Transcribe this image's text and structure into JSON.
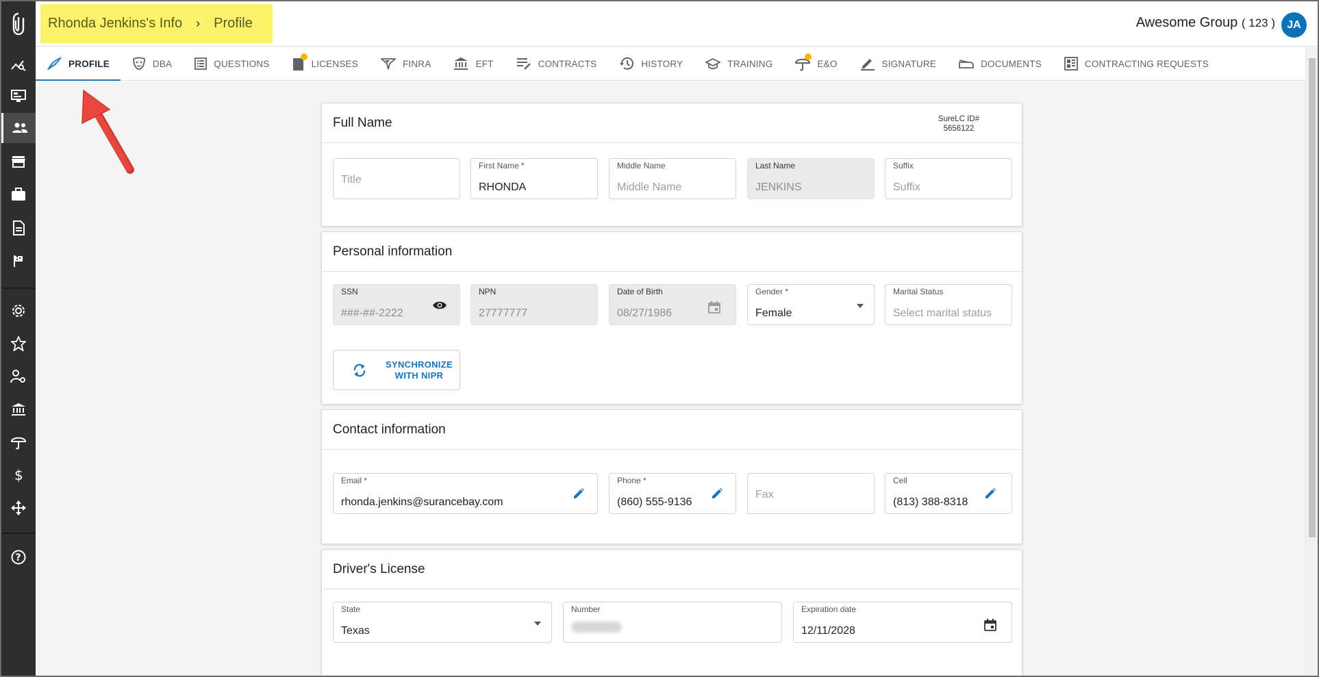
{
  "header": {
    "breadcrumb_root": "Rhonda Jenkins's Info",
    "breadcrumb_page": "Profile",
    "group_label": "Awesome Group",
    "group_count": "( 123 )",
    "avatar_initials": "JA"
  },
  "rail_icons": [
    "logo-icon",
    "analytics-icon",
    "monitor-icon",
    "people-icon",
    "store-icon",
    "briefcase-icon",
    "document-icon",
    "flag-icon",
    "gear-icon",
    "badge-icon",
    "user-settings-icon",
    "bank-icon",
    "umbrella-icon",
    "dollar-icon",
    "move-icon",
    "help-icon"
  ],
  "tabs": [
    {
      "label": "PROFILE",
      "icon": "feather-icon",
      "active": true
    },
    {
      "label": "DBA",
      "icon": "mask-icon"
    },
    {
      "label": "QUESTIONS",
      "icon": "list-icon"
    },
    {
      "label": "LICENSES",
      "icon": "license-icon",
      "badge": true
    },
    {
      "label": "FINRA",
      "icon": "finra-icon"
    },
    {
      "label": "EFT",
      "icon": "bank-icon"
    },
    {
      "label": "CONTRACTS",
      "icon": "contracts-icon"
    },
    {
      "label": "HISTORY",
      "icon": "history-icon"
    },
    {
      "label": "TRAINING",
      "icon": "graduation-icon"
    },
    {
      "label": "E&O",
      "icon": "umbrella-icon",
      "badge": true
    },
    {
      "label": "SIGNATURE",
      "icon": "pen-icon"
    },
    {
      "label": "DOCUMENTS",
      "icon": "stapler-icon"
    },
    {
      "label": "CONTRACTING REQUESTS",
      "icon": "dashboard-icon"
    }
  ],
  "full_name": {
    "title": "Full Name",
    "surelc_label": "SureLC ID#",
    "surelc_id": "5656122",
    "title_field": {
      "placeholder": "Title"
    },
    "first_name": {
      "label": "First Name *",
      "value": "RHONDA"
    },
    "middle_name": {
      "label": "Middle Name",
      "placeholder": "Middle Name"
    },
    "last_name": {
      "label": "Last Name",
      "value": "JENKINS"
    },
    "suffix": {
      "label": "Suffix",
      "placeholder": "Suffix"
    }
  },
  "personal": {
    "title": "Personal information",
    "ssn": {
      "label": "SSN",
      "value": "###-##-2222"
    },
    "npn": {
      "label": "NPN",
      "value": "27777777"
    },
    "dob": {
      "label": "Date of Birth",
      "value": "08/27/1986"
    },
    "gender": {
      "label": "Gender *",
      "value": "Female"
    },
    "marital": {
      "label": "Marital Status",
      "placeholder": "Select marital status"
    },
    "sync_line1": "SYNCHRONIZE",
    "sync_line2": "WITH NIPR"
  },
  "contact": {
    "title": "Contact information",
    "email": {
      "label": "Email *",
      "value": "rhonda.jenkins@surancebay.com"
    },
    "phone": {
      "label": "Phone *",
      "value": "(860) 555-9136"
    },
    "fax": {
      "placeholder": "Fax"
    },
    "cell": {
      "label": "Cell",
      "value": "(813) 388-8318"
    }
  },
  "license": {
    "title": "Driver's License",
    "state": {
      "label": "State",
      "value": "Texas"
    },
    "number": {
      "label": "Number"
    },
    "expiration": {
      "label": "Expiration date",
      "value": "12/11/2028"
    }
  },
  "colors": {
    "accent": "#1b74b7",
    "highlight": "#faf36b",
    "rail": "#2e2e2e",
    "arrow": "#e8473f"
  }
}
